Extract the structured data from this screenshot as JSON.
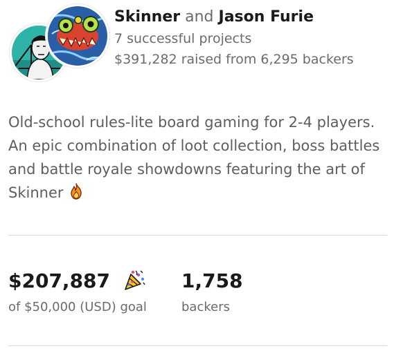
{
  "creators": {
    "name_1": "Skinner",
    "connector": "and",
    "name_2": "Jason Furie",
    "projects": "7 successful projects",
    "raised": "$391,282 raised from 6,295 backers"
  },
  "icons": {
    "avatar_1": "portrait-avatar",
    "avatar_2": "monster-art-avatar",
    "fire": "fire-emoji",
    "celebration": "party-popper-emoji"
  },
  "blurb": "Old-school rules-lite board gaming for 2-4 players. An epic combination of loot collection, boss battles and battle royale showdowns featuring the art of Skinner",
  "stats": {
    "pledged": "$207,887",
    "goal": "of $50,000 (USD) goal",
    "backers_count": "1,758",
    "backers_label": "backers"
  },
  "colors": {
    "text_primary": "#1a1a1a",
    "text_secondary": "#6b6b6b",
    "divider": "#dcdcdc",
    "avatar_bg_1": "#2fb3a8",
    "avatar_bg_2": "#2a5fa8"
  }
}
